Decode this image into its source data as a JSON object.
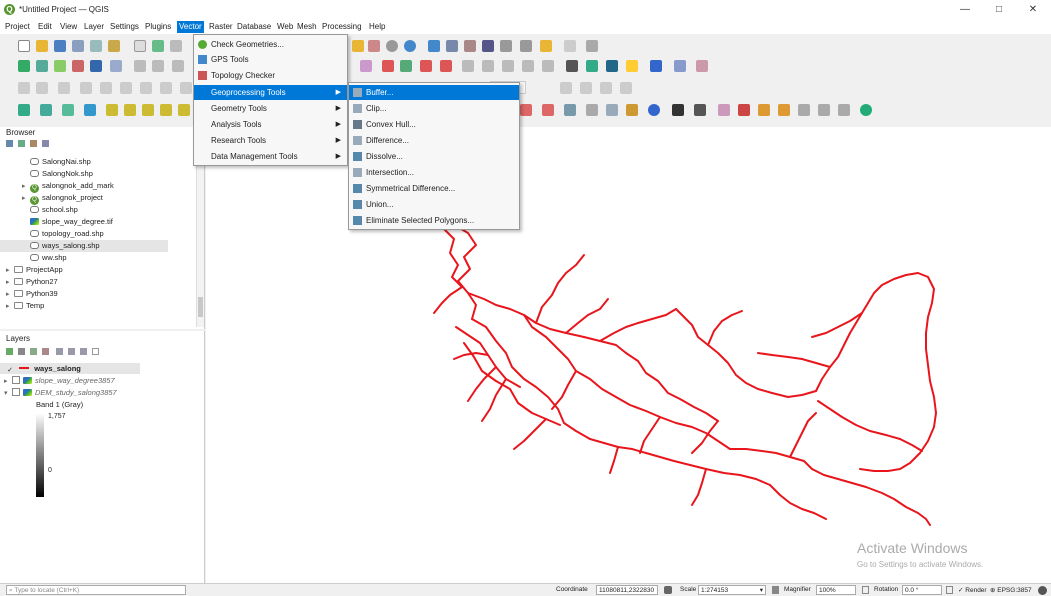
{
  "window": {
    "title": "*Untitled Project — QGIS",
    "minimize_glyph": "—",
    "maximize_glyph": "□",
    "close_glyph": "✕"
  },
  "menubar": {
    "items": [
      "Project",
      "Edit",
      "View",
      "Layer",
      "Settings",
      "Plugins",
      "Vector",
      "Raster",
      "Database",
      "Web",
      "Mesh",
      "Processing",
      "Help"
    ],
    "active": "Vector"
  },
  "vector_menu": {
    "items": [
      {
        "label": "Check Geometries...",
        "icon": "check-geometries-icon",
        "submenu": false
      },
      {
        "label": "GPS Tools",
        "icon": "gps-icon",
        "submenu": false
      },
      {
        "label": "Topology Checker",
        "icon": "topology-icon",
        "submenu": false
      },
      {
        "label": "Geoprocessing Tools",
        "icon": "",
        "submenu": true,
        "highlighted": true
      },
      {
        "label": "Geometry Tools",
        "icon": "",
        "submenu": true
      },
      {
        "label": "Analysis Tools",
        "icon": "",
        "submenu": true
      },
      {
        "label": "Research Tools",
        "icon": "",
        "submenu": true
      },
      {
        "label": "Data Management Tools",
        "icon": "",
        "submenu": true
      }
    ]
  },
  "geoprocessing_submenu": {
    "items": [
      {
        "label": "Buffer...",
        "highlighted": true
      },
      {
        "label": "Clip..."
      },
      {
        "label": "Convex Hull..."
      },
      {
        "label": "Difference..."
      },
      {
        "label": "Dissolve..."
      },
      {
        "label": "Intersection..."
      },
      {
        "label": "Symmetrical Difference..."
      },
      {
        "label": "Union..."
      },
      {
        "label": "Eliminate Selected Polygons..."
      }
    ]
  },
  "browser": {
    "title": "Browser",
    "items": [
      {
        "label": "SalongNai.shp",
        "type": "shp",
        "indent": 2
      },
      {
        "label": "SalongNok.shp",
        "type": "shp",
        "indent": 2
      },
      {
        "label": "salongnok_add_mark",
        "type": "qgis",
        "indent": 1,
        "arrow": "▸"
      },
      {
        "label": "salongnok_project",
        "type": "qgis",
        "indent": 1,
        "arrow": "▸"
      },
      {
        "label": "school.shp",
        "type": "shp",
        "indent": 2
      },
      {
        "label": "slope_way_degree.tif",
        "type": "tif",
        "indent": 2
      },
      {
        "label": "topology_road.shp",
        "type": "shp",
        "indent": 2
      },
      {
        "label": "ways_salong.shp",
        "type": "shp",
        "indent": 2,
        "selected": true
      },
      {
        "label": "ww.shp",
        "type": "shp",
        "indent": 2
      },
      {
        "label": "ProjectApp",
        "type": "folder",
        "indent": 0,
        "arrow": "▸"
      },
      {
        "label": "Python27",
        "type": "folder",
        "indent": 0,
        "arrow": "▸"
      },
      {
        "label": "Python39",
        "type": "folder",
        "indent": 0,
        "arrow": "▸"
      },
      {
        "label": "Temp",
        "type": "folder",
        "indent": 0,
        "arrow": "▸"
      }
    ]
  },
  "layers": {
    "title": "Layers",
    "items": [
      {
        "label": "ways_salong",
        "checked": true,
        "style": "bold"
      },
      {
        "label": "slope_way_degree3857",
        "checked": false,
        "style": "italic"
      },
      {
        "label": "DEM_study_salong3857",
        "checked": false,
        "style": "italic"
      }
    ],
    "band_label": "Band 1 (Gray)",
    "ramp_max": "1,757",
    "ramp_min": "0"
  },
  "statusbar": {
    "locate_placeholder": "Type to locate (Ctrl+K)",
    "coordinate_label": "Coordinate",
    "coordinate_value": "11080811,2322830",
    "scale_label": "Scale",
    "scale_value": "1:274153",
    "magnifier_label": "Magnifier",
    "magnifier_value": "100%",
    "rotation_label": "Rotation",
    "rotation_value": "0.0 °",
    "render_label": "Render",
    "crs_label": "EPSG:3857"
  },
  "watermark": {
    "line1": "Activate Windows",
    "line2": "Go to Settings to activate Windows."
  },
  "colors": {
    "accent": "#0078d7",
    "road_line": "#e8161c",
    "qgis_green": "#589632"
  }
}
